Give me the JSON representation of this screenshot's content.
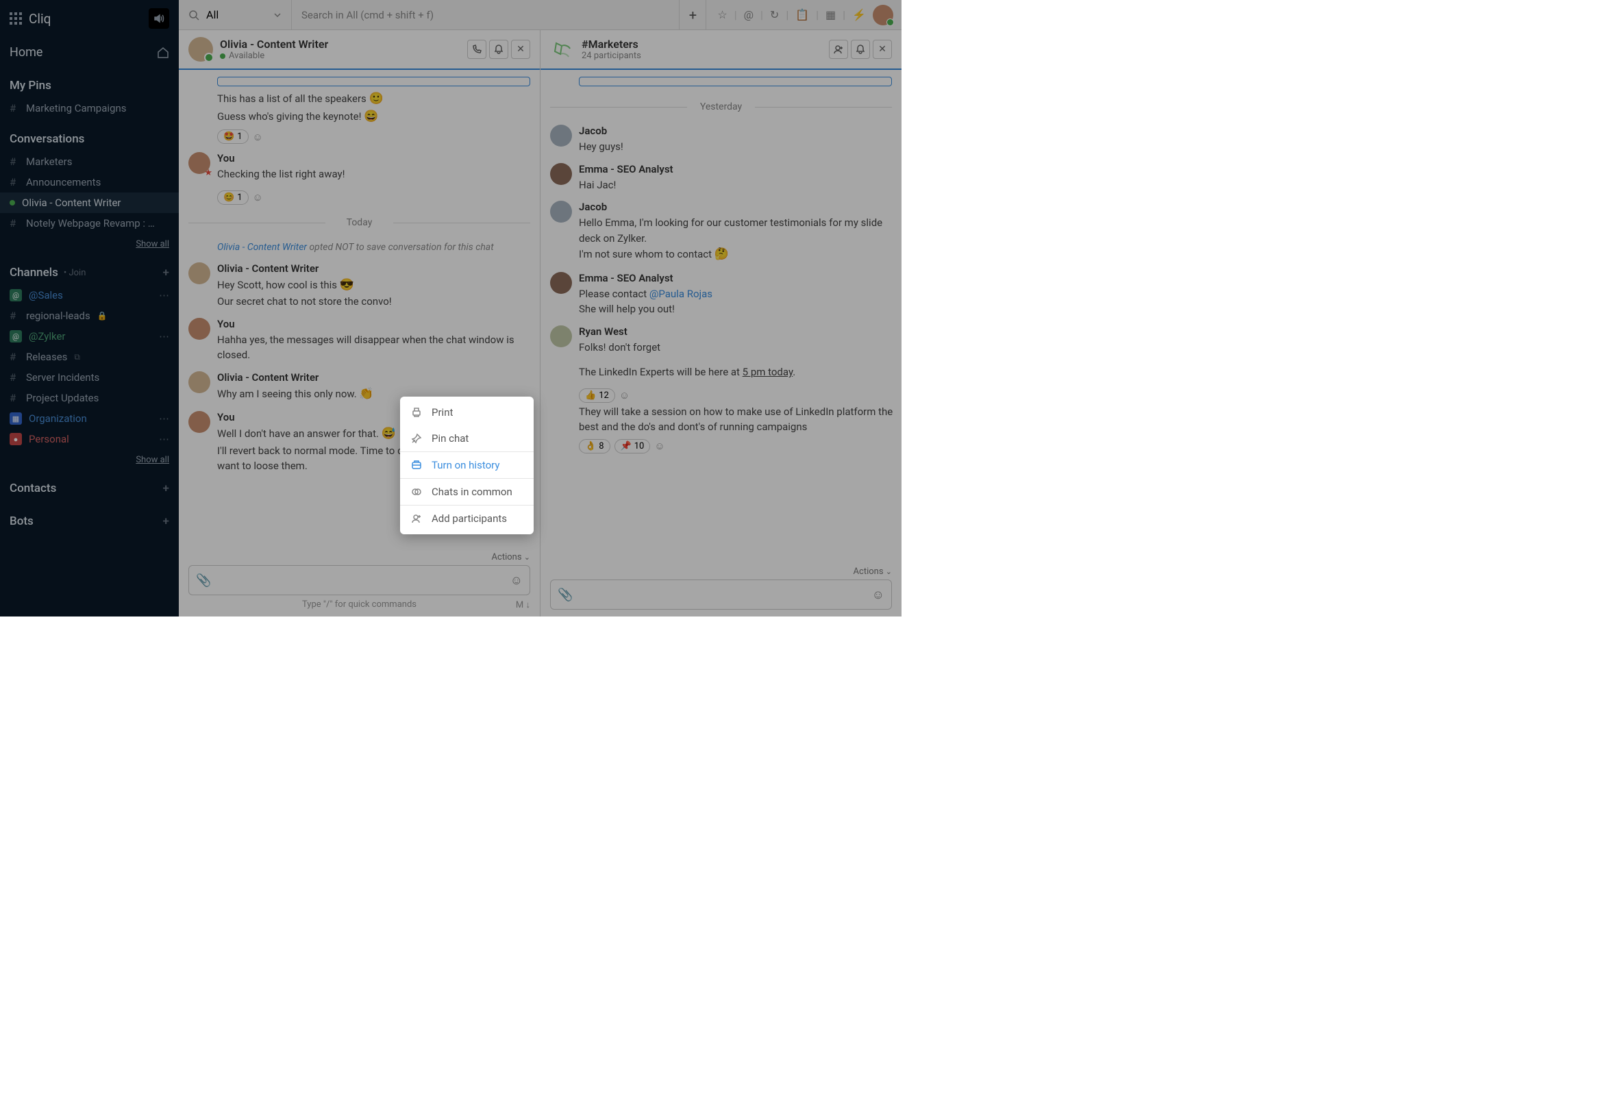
{
  "brand": "Cliq",
  "sidebar": {
    "home": "Home",
    "pins": {
      "heading": "My Pins",
      "items": [
        "Marketing Campaigns"
      ]
    },
    "convos": {
      "heading": "Conversations",
      "items": [
        {
          "label": "Marketers",
          "type": "hash"
        },
        {
          "label": "Announcements",
          "type": "hash"
        },
        {
          "label": "Olivia - Content Writer",
          "type": "dot",
          "active": true
        },
        {
          "label": "Notely Webpage Revamp : …",
          "type": "hash"
        }
      ],
      "show_all": "Show all"
    },
    "channels": {
      "heading": "Channels",
      "join": "Join",
      "items": [
        {
          "label": "@Sales",
          "icon": "sq-green",
          "color": "blue"
        },
        {
          "label": "regional-leads",
          "icon": "hash",
          "locked": true
        },
        {
          "label": "@Zylker",
          "icon": "sq-green",
          "color": "green"
        },
        {
          "label": "Releases",
          "icon": "hash",
          "link": true
        },
        {
          "label": "Server Incidents",
          "icon": "hash"
        },
        {
          "label": "Project Updates",
          "icon": "hash"
        },
        {
          "label": "Organization",
          "icon": "sq-blue",
          "color": "blue"
        },
        {
          "label": "Personal",
          "icon": "sq-red",
          "color": "red"
        }
      ],
      "show_all": "Show all"
    },
    "contacts": "Contacts",
    "bots": "Bots"
  },
  "topbar": {
    "all": "All",
    "search_placeholder": "Search in All (cmd + shift + f)"
  },
  "left_chat": {
    "title": "Olivia - Content Writer",
    "subtitle": "Available",
    "messages": {
      "m1a": "This has a list of all the speakers",
      "m1b": "Guess who's giving the keynote!",
      "r1_count": "1",
      "m2_author": "You",
      "m2": "Checking  the list right away!",
      "r2_count": "1",
      "date": "Today",
      "sys_who": "Olivia - Content Writer",
      "sys_rest": " opted NOT to save conversation for this chat",
      "m3_author": "Olivia - Content Writer",
      "m3a": "Hey Scott, how cool is this",
      "m3b": "Our secret chat to not store the convo!",
      "m4_author": "You",
      "m4": "Hahha yes, the messages will disappear when the chat window is closed.",
      "m5_author": "Olivia - Content Writer",
      "m5": "Why am I seeing this only now.",
      "m6_author": "You",
      "m6a": "Well I don't have an answer for that.",
      "m6b": "I'll revert back to normal mode. Time to discuss the events and don't want to loose them."
    },
    "actions": "Actions",
    "hint": "Type \"/\" for quick commands",
    "meta": "M ↓"
  },
  "right_chat": {
    "title": "#Marketers",
    "subtitle": "24 participants",
    "date": "Yesterday",
    "messages": {
      "m1_author": "Jacob",
      "m1": "Hey guys!",
      "m2_author": "Emma - SEO Analyst",
      "m2": "Hai Jac!",
      "m3_author": "Jacob",
      "m3a": "Hello Emma, I'm looking for our customer testimonials for my slide deck on Zylker.",
      "m3b": " I'm not sure whom to contact",
      "m4_author": "Emma - SEO Analyst",
      "m4a": "Please contact ",
      "m4_mention": "@Paula Rojas",
      "m4b": " She will help you out!",
      "m5_author": "Ryan West",
      "m5a": "Folks! don't forget",
      "m5b_pre": "The LinkedIn Experts will be here at ",
      "m5b_time": "5 pm today",
      "r5_count": "12",
      "m5c": "They will take a session on how to make use of LinkedIn platform the best and the do's and dont's of running campaigns",
      "r6a_count": "8",
      "r6b_count": "10"
    },
    "actions": "Actions"
  },
  "context_menu": {
    "print": "Print",
    "pin": "Pin chat",
    "history": "Turn on history",
    "common": "Chats in common",
    "add": "Add participants"
  }
}
